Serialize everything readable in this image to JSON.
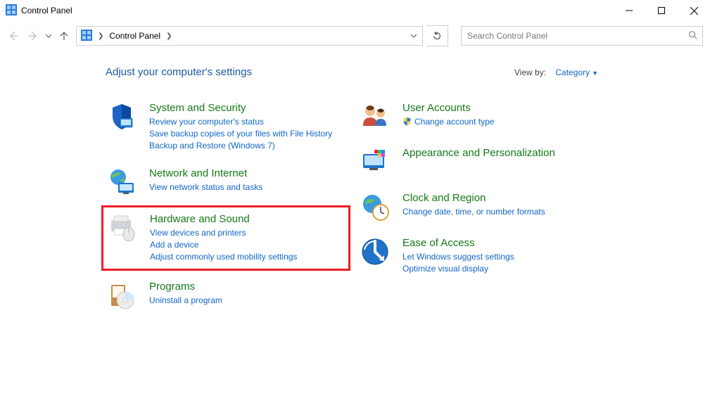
{
  "window": {
    "title": "Control Panel"
  },
  "breadcrumb": {
    "root": "Control Panel"
  },
  "search": {
    "placeholder": "Search Control Panel"
  },
  "heading": "Adjust your computer's settings",
  "viewby": {
    "label": "View by:",
    "value": "Category"
  },
  "left_items": [
    {
      "title": "System and Security",
      "links": [
        "Review your computer's status",
        "Save backup copies of your files with File History",
        "Backup and Restore (Windows 7)"
      ]
    },
    {
      "title": "Network and Internet",
      "links": [
        "View network status and tasks"
      ]
    },
    {
      "title": "Hardware and Sound",
      "links": [
        "View devices and printers",
        "Add a device",
        "Adjust commonly used mobility settings"
      ],
      "highlighted": true
    },
    {
      "title": "Programs",
      "links": [
        "Uninstall a program"
      ]
    }
  ],
  "right_items": [
    {
      "title": "User Accounts",
      "links": [
        "Change account type"
      ],
      "shielded": [
        true
      ]
    },
    {
      "title": "Appearance and Personalization",
      "links": []
    },
    {
      "title": "Clock and Region",
      "links": [
        "Change date, time, or number formats"
      ]
    },
    {
      "title": "Ease of Access",
      "links": [
        "Let Windows suggest settings",
        "Optimize visual display"
      ]
    }
  ]
}
